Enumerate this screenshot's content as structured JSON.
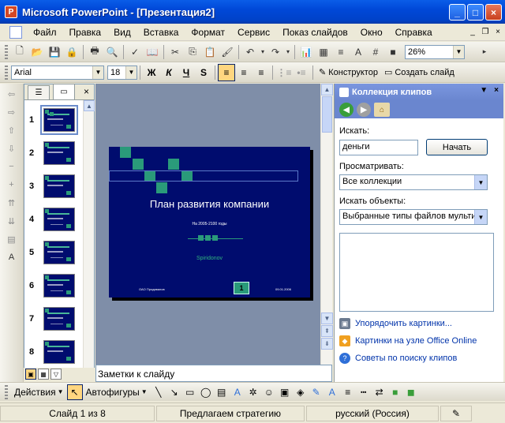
{
  "window": {
    "title": "Microsoft PowerPoint - [Презентация2]",
    "buttons": [
      "_",
      "□",
      "×"
    ]
  },
  "menu": {
    "items": [
      "Файл",
      "Правка",
      "Вид",
      "Вставка",
      "Формат",
      "Сервис",
      "Показ слайдов",
      "Окно",
      "Справка"
    ]
  },
  "toolbar": {
    "zoom_value": "26%",
    "font_name": "Arial",
    "font_size": "18",
    "bold_label": "Ж",
    "italic_label": "К",
    "underline_label": "Ч",
    "shadow_label": "S",
    "designer_label": "Конструктор",
    "new_slide_label": "Создать слайд"
  },
  "slides_panel": {
    "slides": [
      {
        "number": "1"
      },
      {
        "number": "2"
      },
      {
        "number": "3"
      },
      {
        "number": "4"
      },
      {
        "number": "5"
      },
      {
        "number": "6"
      },
      {
        "number": "7"
      },
      {
        "number": "8"
      }
    ]
  },
  "slide": {
    "title": "План развития компании",
    "subtitle": "На 2005-2100 годы",
    "author": "Spiridonov",
    "footer_left": "ОАО Продавалов",
    "footer_right": "09.01.2006",
    "number": "1"
  },
  "notes": {
    "placeholder": "Заметки к слайду"
  },
  "taskpane": {
    "title": "Коллекция клипов",
    "search_label": "Искать:",
    "search_value": "деньги",
    "search_button": "Начать",
    "browse_label": "Просматривать:",
    "browse_value": "Все коллекции",
    "types_label": "Искать объекты:",
    "types_value": "Выбранные типы файлов мульти",
    "links": [
      "Упорядочить картинки...",
      "Картинки на узле Office Online",
      "Советы по поиску клипов"
    ]
  },
  "drawbar": {
    "actions_label": "Действия",
    "autoshapes_label": "Автофигуры"
  },
  "status": {
    "slide_info": "Слайд 1 из 8",
    "design": "Предлагаем стратегию",
    "language": "русский (Россия)"
  }
}
